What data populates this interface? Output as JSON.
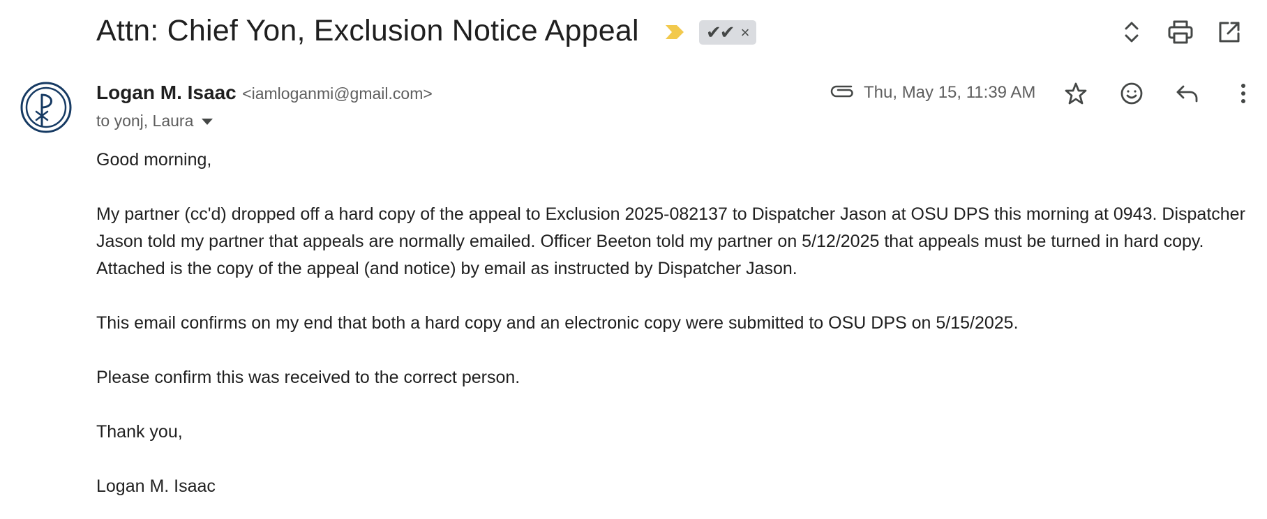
{
  "email": {
    "subject": "Attn: Chief Yon, Exclusion Notice Appeal",
    "label": "✔✔",
    "label_close": "×",
    "sender": {
      "name": "Logan M. Isaac",
      "email": "<iamloganmi@gmail.com>"
    },
    "to_text": "to yonj, Laura",
    "date": "Thu, May 15, 11:39 AM",
    "body": {
      "greeting": "Good morning,",
      "p1": "My partner (cc'd) dropped off a hard copy of the appeal to Exclusion 2025-082137 to Dispatcher Jason at OSU DPS this morning at 0943. Dispatcher Jason told my partner that appeals are normally emailed. Officer Beeton told my partner on 5/12/2025 that appeals must be turned in hard copy. Attached is the copy of the appeal (and notice) by email as instructed by Dispatcher Jason.",
      "p2": "This email confirms on my end that both a hard copy and an electronic copy were submitted to OSU DPS on 5/15/2025.",
      "p3": "Please confirm this was received to the correct person.",
      "closing": "Thank you,",
      "signature": "Logan M. Isaac"
    }
  },
  "icons": {
    "importance": "importance-marker-icon",
    "expand": "expand-all-icon",
    "print": "print-icon",
    "open_new": "open-in-new-window-icon",
    "avatar": "chi-rho-avatar",
    "attachment": "paperclip-icon",
    "star": "star-icon",
    "emoji": "emoji-reaction-icon",
    "reply": "reply-icon",
    "more": "more-vertical-icon"
  },
  "colors": {
    "importance": "#f2c94c",
    "avatar": "#163a63",
    "label_bg": "#dadce0",
    "icon": "#444746"
  }
}
